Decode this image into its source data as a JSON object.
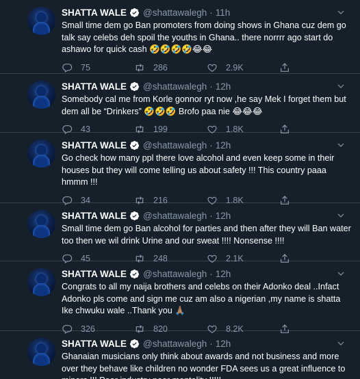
{
  "colors": {
    "background": "#15202b",
    "divider": "#38444d",
    "secondary_text": "#8899a6",
    "verified_badge": "#ffffff"
  },
  "tweets": [
    {
      "name": "SHATTA WALE",
      "handle": "@shattawalegh",
      "dot": "·",
      "time": "11h",
      "text": "Small time dem go Ban promoters from doing shows in Ghana cuz dem go talk say celebs deh spoil the youths in Ghana.. there norrrr ago start do ashawo for quick cash 🤣🤣🤣🤣😂😂",
      "replies": "75",
      "retweets": "286",
      "likes": "2.9K"
    },
    {
      "name": "SHATTA WALE",
      "handle": "@shattawalegh",
      "dot": "·",
      "time": "12h",
      "text": "Somebody cal me from Korle gonnor ryt now ,he say Mek I forget them but dem all be “Drinkers” 🤣🤣🤣 Brofo paa nie 😂😂😂",
      "replies": "43",
      "retweets": "199",
      "likes": "1.8K"
    },
    {
      "name": "SHATTA WALE",
      "handle": "@shattawalegh",
      "dot": "·",
      "time": "12h",
      "text": "Go check how many ppl there love alcohol and even keep some in their houses but they will come telling us about safety !!! This country paaa hmmm !!!",
      "replies": "34",
      "retweets": "216",
      "likes": "1.8K"
    },
    {
      "name": "SHATTA WALE",
      "handle": "@shattawalegh",
      "dot": "·",
      "time": "12h",
      "text": "Small time dem go Ban alcohol for parties and then after they will Ban water too then we wil drink Urine and our sweat !!!! Nonsense !!!!",
      "replies": "45",
      "retweets": "248",
      "likes": "2.1K"
    },
    {
      "name": "SHATTA WALE",
      "handle": "@shattawalegh",
      "dot": "·",
      "time": "12h",
      "text": "Congrats to all my naija brothers and celebs on their Adonko deal ..Infact Adonko pls come and sign me cuz am also a nigerian ,my name is shatta Ike chwuku wale ..Thank you 🙏🏽",
      "replies": "326",
      "retweets": "820",
      "likes": "8.2K"
    },
    {
      "name": "SHATTA WALE",
      "handle": "@shattawalegh",
      "dot": "·",
      "time": "12h",
      "text": "Ghanaian musicians only think about awards and not business and more over they behave like children no wonder FDA sees us a great influence to minors !!! Poor industry poor mentality !!!!!",
      "replies": "",
      "retweets": "",
      "likes": ""
    }
  ]
}
